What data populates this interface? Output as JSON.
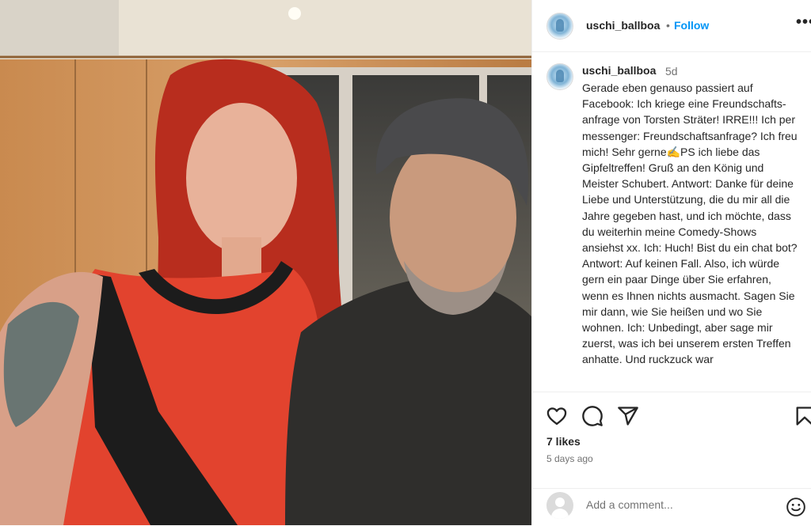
{
  "post": {
    "username": "uschi_ballboa",
    "dot": "•",
    "follow_label": "Follow",
    "more_label": "•••",
    "time_short": "5d",
    "caption": "Gerade eben genauso passiert auf Facebook: Ich kriege eine Freundschafts-anfrage von Torsten Sträter! IRRE!!! Ich per messenger: Freundschaftsanfrage? Ich freu mich! Sehr gerne✍️PS ich liebe das Gipfeltreffen! Gruß an den König und Meister Schubert. Antwort: Danke für deine Liebe und Unterstützung, die du mir all die Jahre gegeben hast, und ich möchte, dass du weiterhin meine Comedy-Shows ansiehst xx. Ich: Huch! Bist du ein chat bot? Antwort: Auf keinen Fall. Also, ich würde gern ein paar Dinge über Sie erfahren, wenn es Ihnen nichts ausmacht. Sagen Sie mir dann, wie Sie heißen und wo Sie wohnen. Ich: Unbedingt, aber sage mir zuerst, was ich bei unserem ersten Treffen anhatte.      Und ruckzuck war",
    "likes": "7 likes",
    "time_ago": "5 days ago",
    "comment_placeholder": "Add a comment..."
  },
  "icons": {
    "like": "heart-icon",
    "comment": "comment-icon",
    "share": "share-icon",
    "save": "bookmark-icon",
    "emoji": "emoji-icon"
  },
  "colors": {
    "link": "#0095f6",
    "text": "#262626",
    "muted": "#737373",
    "border": "#efefef"
  }
}
